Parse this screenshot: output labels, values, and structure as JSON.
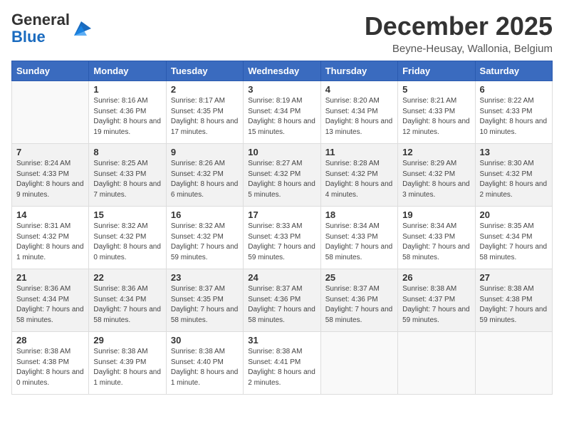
{
  "header": {
    "logo_general": "General",
    "logo_blue": "Blue",
    "month_title": "December 2025",
    "location": "Beyne-Heusay, Wallonia, Belgium"
  },
  "weekdays": [
    "Sunday",
    "Monday",
    "Tuesday",
    "Wednesday",
    "Thursday",
    "Friday",
    "Saturday"
  ],
  "weeks": [
    [
      {
        "day": "",
        "sunrise": "",
        "sunset": "",
        "daylight": ""
      },
      {
        "day": "1",
        "sunrise": "Sunrise: 8:16 AM",
        "sunset": "Sunset: 4:36 PM",
        "daylight": "Daylight: 8 hours and 19 minutes."
      },
      {
        "day": "2",
        "sunrise": "Sunrise: 8:17 AM",
        "sunset": "Sunset: 4:35 PM",
        "daylight": "Daylight: 8 hours and 17 minutes."
      },
      {
        "day": "3",
        "sunrise": "Sunrise: 8:19 AM",
        "sunset": "Sunset: 4:34 PM",
        "daylight": "Daylight: 8 hours and 15 minutes."
      },
      {
        "day": "4",
        "sunrise": "Sunrise: 8:20 AM",
        "sunset": "Sunset: 4:34 PM",
        "daylight": "Daylight: 8 hours and 13 minutes."
      },
      {
        "day": "5",
        "sunrise": "Sunrise: 8:21 AM",
        "sunset": "Sunset: 4:33 PM",
        "daylight": "Daylight: 8 hours and 12 minutes."
      },
      {
        "day": "6",
        "sunrise": "Sunrise: 8:22 AM",
        "sunset": "Sunset: 4:33 PM",
        "daylight": "Daylight: 8 hours and 10 minutes."
      }
    ],
    [
      {
        "day": "7",
        "sunrise": "Sunrise: 8:24 AM",
        "sunset": "Sunset: 4:33 PM",
        "daylight": "Daylight: 8 hours and 9 minutes."
      },
      {
        "day": "8",
        "sunrise": "Sunrise: 8:25 AM",
        "sunset": "Sunset: 4:33 PM",
        "daylight": "Daylight: 8 hours and 7 minutes."
      },
      {
        "day": "9",
        "sunrise": "Sunrise: 8:26 AM",
        "sunset": "Sunset: 4:32 PM",
        "daylight": "Daylight: 8 hours and 6 minutes."
      },
      {
        "day": "10",
        "sunrise": "Sunrise: 8:27 AM",
        "sunset": "Sunset: 4:32 PM",
        "daylight": "Daylight: 8 hours and 5 minutes."
      },
      {
        "day": "11",
        "sunrise": "Sunrise: 8:28 AM",
        "sunset": "Sunset: 4:32 PM",
        "daylight": "Daylight: 8 hours and 4 minutes."
      },
      {
        "day": "12",
        "sunrise": "Sunrise: 8:29 AM",
        "sunset": "Sunset: 4:32 PM",
        "daylight": "Daylight: 8 hours and 3 minutes."
      },
      {
        "day": "13",
        "sunrise": "Sunrise: 8:30 AM",
        "sunset": "Sunset: 4:32 PM",
        "daylight": "Daylight: 8 hours and 2 minutes."
      }
    ],
    [
      {
        "day": "14",
        "sunrise": "Sunrise: 8:31 AM",
        "sunset": "Sunset: 4:32 PM",
        "daylight": "Daylight: 8 hours and 1 minute."
      },
      {
        "day": "15",
        "sunrise": "Sunrise: 8:32 AM",
        "sunset": "Sunset: 4:32 PM",
        "daylight": "Daylight: 8 hours and 0 minutes."
      },
      {
        "day": "16",
        "sunrise": "Sunrise: 8:32 AM",
        "sunset": "Sunset: 4:32 PM",
        "daylight": "Daylight: 7 hours and 59 minutes."
      },
      {
        "day": "17",
        "sunrise": "Sunrise: 8:33 AM",
        "sunset": "Sunset: 4:33 PM",
        "daylight": "Daylight: 7 hours and 59 minutes."
      },
      {
        "day": "18",
        "sunrise": "Sunrise: 8:34 AM",
        "sunset": "Sunset: 4:33 PM",
        "daylight": "Daylight: 7 hours and 58 minutes."
      },
      {
        "day": "19",
        "sunrise": "Sunrise: 8:34 AM",
        "sunset": "Sunset: 4:33 PM",
        "daylight": "Daylight: 7 hours and 58 minutes."
      },
      {
        "day": "20",
        "sunrise": "Sunrise: 8:35 AM",
        "sunset": "Sunset: 4:34 PM",
        "daylight": "Daylight: 7 hours and 58 minutes."
      }
    ],
    [
      {
        "day": "21",
        "sunrise": "Sunrise: 8:36 AM",
        "sunset": "Sunset: 4:34 PM",
        "daylight": "Daylight: 7 hours and 58 minutes."
      },
      {
        "day": "22",
        "sunrise": "Sunrise: 8:36 AM",
        "sunset": "Sunset: 4:34 PM",
        "daylight": "Daylight: 7 hours and 58 minutes."
      },
      {
        "day": "23",
        "sunrise": "Sunrise: 8:37 AM",
        "sunset": "Sunset: 4:35 PM",
        "daylight": "Daylight: 7 hours and 58 minutes."
      },
      {
        "day": "24",
        "sunrise": "Sunrise: 8:37 AM",
        "sunset": "Sunset: 4:36 PM",
        "daylight": "Daylight: 7 hours and 58 minutes."
      },
      {
        "day": "25",
        "sunrise": "Sunrise: 8:37 AM",
        "sunset": "Sunset: 4:36 PM",
        "daylight": "Daylight: 7 hours and 58 minutes."
      },
      {
        "day": "26",
        "sunrise": "Sunrise: 8:38 AM",
        "sunset": "Sunset: 4:37 PM",
        "daylight": "Daylight: 7 hours and 59 minutes."
      },
      {
        "day": "27",
        "sunrise": "Sunrise: 8:38 AM",
        "sunset": "Sunset: 4:38 PM",
        "daylight": "Daylight: 7 hours and 59 minutes."
      }
    ],
    [
      {
        "day": "28",
        "sunrise": "Sunrise: 8:38 AM",
        "sunset": "Sunset: 4:38 PM",
        "daylight": "Daylight: 8 hours and 0 minutes."
      },
      {
        "day": "29",
        "sunrise": "Sunrise: 8:38 AM",
        "sunset": "Sunset: 4:39 PM",
        "daylight": "Daylight: 8 hours and 1 minute."
      },
      {
        "day": "30",
        "sunrise": "Sunrise: 8:38 AM",
        "sunset": "Sunset: 4:40 PM",
        "daylight": "Daylight: 8 hours and 1 minute."
      },
      {
        "day": "31",
        "sunrise": "Sunrise: 8:38 AM",
        "sunset": "Sunset: 4:41 PM",
        "daylight": "Daylight: 8 hours and 2 minutes."
      },
      {
        "day": "",
        "sunrise": "",
        "sunset": "",
        "daylight": ""
      },
      {
        "day": "",
        "sunrise": "",
        "sunset": "",
        "daylight": ""
      },
      {
        "day": "",
        "sunrise": "",
        "sunset": "",
        "daylight": ""
      }
    ]
  ]
}
